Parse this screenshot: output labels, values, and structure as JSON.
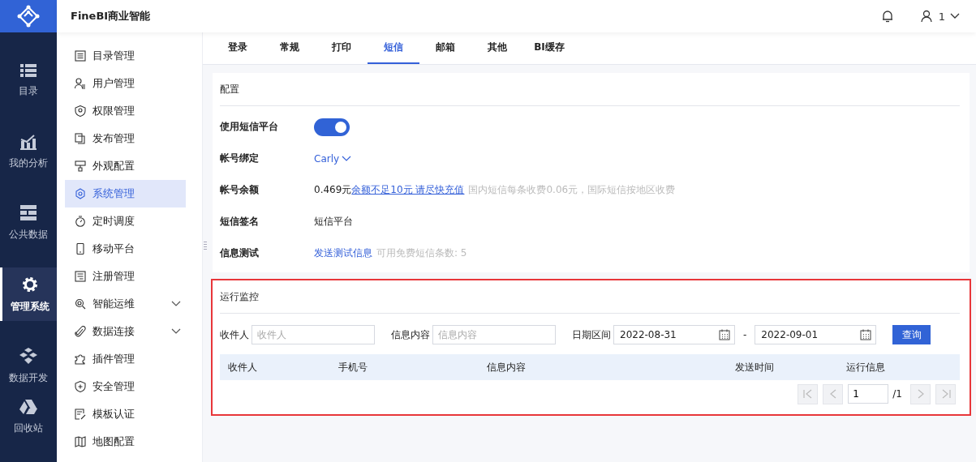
{
  "app": {
    "title": "FineBI商业智能",
    "user": "1"
  },
  "rail": [
    {
      "label": "目录",
      "kind": "list",
      "selected": false
    },
    {
      "label": "我的分析",
      "kind": "chart",
      "selected": false
    },
    {
      "label": "公共数据",
      "kind": "data",
      "selected": false
    },
    {
      "label": "管理系统",
      "kind": "gear",
      "selected": true
    },
    {
      "label": "数据开发",
      "kind": "cubes",
      "selected": false
    },
    {
      "label": "回收站",
      "kind": "triangle",
      "selected": false
    }
  ],
  "menu": [
    {
      "label": "目录管理",
      "kind": "list",
      "selected": false
    },
    {
      "label": "用户管理",
      "kind": "user",
      "selected": false
    },
    {
      "label": "权限管理",
      "kind": "shield",
      "selected": false
    },
    {
      "label": "发布管理",
      "kind": "doc",
      "selected": false
    },
    {
      "label": "外观配置",
      "kind": "brush",
      "selected": false
    },
    {
      "label": "系统管理",
      "kind": "gear",
      "selected": true
    },
    {
      "label": "定时调度",
      "kind": "timer",
      "selected": false
    },
    {
      "label": "移动平台",
      "kind": "phone",
      "selected": false
    },
    {
      "label": "注册管理",
      "kind": "form",
      "selected": false
    },
    {
      "label": "智能运维",
      "kind": "search",
      "selected": false,
      "expanded": false
    },
    {
      "label": "数据连接",
      "kind": "clip",
      "selected": false,
      "expanded": false
    },
    {
      "label": "插件管理",
      "kind": "puzzle",
      "selected": false
    },
    {
      "label": "安全管理",
      "kind": "shieldplus",
      "selected": false
    },
    {
      "label": "模板认证",
      "kind": "edit",
      "selected": false
    },
    {
      "label": "地图配置",
      "kind": "map",
      "selected": false
    }
  ],
  "tabs": [
    {
      "label": "登录",
      "selected": false
    },
    {
      "label": "常规",
      "selected": false
    },
    {
      "label": "打印",
      "selected": false
    },
    {
      "label": "短信",
      "selected": true
    },
    {
      "label": "邮箱",
      "selected": false
    },
    {
      "label": "其他",
      "selected": false
    },
    {
      "label": "BI缓存",
      "selected": false
    }
  ],
  "config": {
    "title": "配置",
    "platform": {
      "label": "使用短信平台",
      "on": true
    },
    "account": {
      "label": "帐号绑定",
      "value": "Carly"
    },
    "balance": {
      "label": "帐号余额",
      "value": "0.469元",
      "link": "余额不足10元 请尽快充值",
      "hint": "国内短信每条收费0.06元，国际短信按地区收费"
    },
    "signature": {
      "label": "短信签名",
      "value": "短信平台"
    },
    "test": {
      "label": "信息测试",
      "link": "发送测试信息",
      "hint": "可用免费短信条数: 5"
    }
  },
  "monitor": {
    "title": "运行监控",
    "highlighted": true,
    "recipient": {
      "label": "收件人",
      "placeholder": "收件人"
    },
    "content": {
      "label": "信息内容",
      "placeholder": "信息内容"
    },
    "date": {
      "label": "日期区间",
      "from": "2022-08-31",
      "separator": "-",
      "to": "2022-09-01"
    },
    "query": "查询",
    "columns": [
      "收件人",
      "手机号",
      "信息内容",
      "发送时间",
      "运行信息"
    ],
    "pager": {
      "page": "1",
      "total": "/1"
    }
  }
}
